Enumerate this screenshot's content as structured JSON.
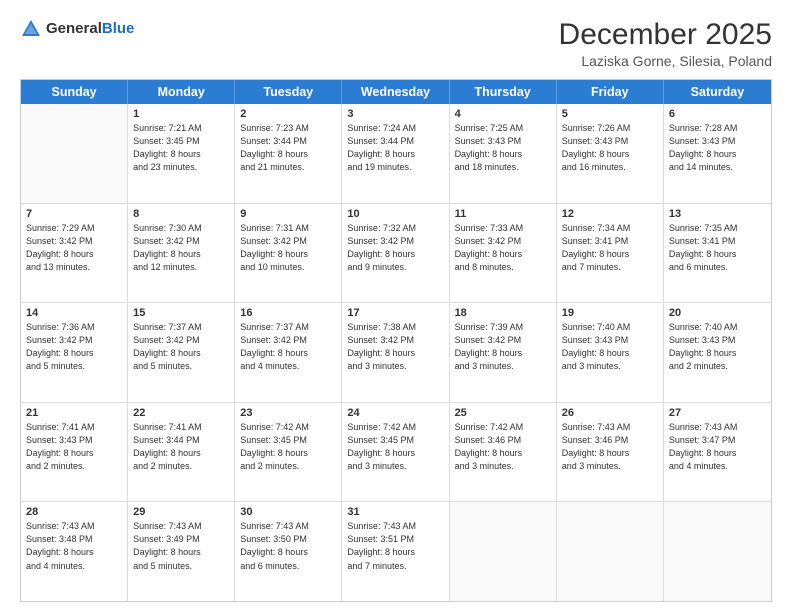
{
  "logo": {
    "general": "General",
    "blue": "Blue"
  },
  "title": "December 2025",
  "subtitle": "Laziska Gorne, Silesia, Poland",
  "calendar": {
    "headers": [
      "Sunday",
      "Monday",
      "Tuesday",
      "Wednesday",
      "Thursday",
      "Friday",
      "Saturday"
    ],
    "rows": [
      [
        {
          "day": "",
          "lines": []
        },
        {
          "day": "1",
          "lines": [
            "Sunrise: 7:21 AM",
            "Sunset: 3:45 PM",
            "Daylight: 8 hours",
            "and 23 minutes."
          ]
        },
        {
          "day": "2",
          "lines": [
            "Sunrise: 7:23 AM",
            "Sunset: 3:44 PM",
            "Daylight: 8 hours",
            "and 21 minutes."
          ]
        },
        {
          "day": "3",
          "lines": [
            "Sunrise: 7:24 AM",
            "Sunset: 3:44 PM",
            "Daylight: 8 hours",
            "and 19 minutes."
          ]
        },
        {
          "day": "4",
          "lines": [
            "Sunrise: 7:25 AM",
            "Sunset: 3:43 PM",
            "Daylight: 8 hours",
            "and 18 minutes."
          ]
        },
        {
          "day": "5",
          "lines": [
            "Sunrise: 7:26 AM",
            "Sunset: 3:43 PM",
            "Daylight: 8 hours",
            "and 16 minutes."
          ]
        },
        {
          "day": "6",
          "lines": [
            "Sunrise: 7:28 AM",
            "Sunset: 3:43 PM",
            "Daylight: 8 hours",
            "and 14 minutes."
          ]
        }
      ],
      [
        {
          "day": "7",
          "lines": [
            "Sunrise: 7:29 AM",
            "Sunset: 3:42 PM",
            "Daylight: 8 hours",
            "and 13 minutes."
          ]
        },
        {
          "day": "8",
          "lines": [
            "Sunrise: 7:30 AM",
            "Sunset: 3:42 PM",
            "Daylight: 8 hours",
            "and 12 minutes."
          ]
        },
        {
          "day": "9",
          "lines": [
            "Sunrise: 7:31 AM",
            "Sunset: 3:42 PM",
            "Daylight: 8 hours",
            "and 10 minutes."
          ]
        },
        {
          "day": "10",
          "lines": [
            "Sunrise: 7:32 AM",
            "Sunset: 3:42 PM",
            "Daylight: 8 hours",
            "and 9 minutes."
          ]
        },
        {
          "day": "11",
          "lines": [
            "Sunrise: 7:33 AM",
            "Sunset: 3:42 PM",
            "Daylight: 8 hours",
            "and 8 minutes."
          ]
        },
        {
          "day": "12",
          "lines": [
            "Sunrise: 7:34 AM",
            "Sunset: 3:41 PM",
            "Daylight: 8 hours",
            "and 7 minutes."
          ]
        },
        {
          "day": "13",
          "lines": [
            "Sunrise: 7:35 AM",
            "Sunset: 3:41 PM",
            "Daylight: 8 hours",
            "and 6 minutes."
          ]
        }
      ],
      [
        {
          "day": "14",
          "lines": [
            "Sunrise: 7:36 AM",
            "Sunset: 3:42 PM",
            "Daylight: 8 hours",
            "and 5 minutes."
          ]
        },
        {
          "day": "15",
          "lines": [
            "Sunrise: 7:37 AM",
            "Sunset: 3:42 PM",
            "Daylight: 8 hours",
            "and 5 minutes."
          ]
        },
        {
          "day": "16",
          "lines": [
            "Sunrise: 7:37 AM",
            "Sunset: 3:42 PM",
            "Daylight: 8 hours",
            "and 4 minutes."
          ]
        },
        {
          "day": "17",
          "lines": [
            "Sunrise: 7:38 AM",
            "Sunset: 3:42 PM",
            "Daylight: 8 hours",
            "and 3 minutes."
          ]
        },
        {
          "day": "18",
          "lines": [
            "Sunrise: 7:39 AM",
            "Sunset: 3:42 PM",
            "Daylight: 8 hours",
            "and 3 minutes."
          ]
        },
        {
          "day": "19",
          "lines": [
            "Sunrise: 7:40 AM",
            "Sunset: 3:43 PM",
            "Daylight: 8 hours",
            "and 3 minutes."
          ]
        },
        {
          "day": "20",
          "lines": [
            "Sunrise: 7:40 AM",
            "Sunset: 3:43 PM",
            "Daylight: 8 hours",
            "and 2 minutes."
          ]
        }
      ],
      [
        {
          "day": "21",
          "lines": [
            "Sunrise: 7:41 AM",
            "Sunset: 3:43 PM",
            "Daylight: 8 hours",
            "and 2 minutes."
          ]
        },
        {
          "day": "22",
          "lines": [
            "Sunrise: 7:41 AM",
            "Sunset: 3:44 PM",
            "Daylight: 8 hours",
            "and 2 minutes."
          ]
        },
        {
          "day": "23",
          "lines": [
            "Sunrise: 7:42 AM",
            "Sunset: 3:45 PM",
            "Daylight: 8 hours",
            "and 2 minutes."
          ]
        },
        {
          "day": "24",
          "lines": [
            "Sunrise: 7:42 AM",
            "Sunset: 3:45 PM",
            "Daylight: 8 hours",
            "and 3 minutes."
          ]
        },
        {
          "day": "25",
          "lines": [
            "Sunrise: 7:42 AM",
            "Sunset: 3:46 PM",
            "Daylight: 8 hours",
            "and 3 minutes."
          ]
        },
        {
          "day": "26",
          "lines": [
            "Sunrise: 7:43 AM",
            "Sunset: 3:46 PM",
            "Daylight: 8 hours",
            "and 3 minutes."
          ]
        },
        {
          "day": "27",
          "lines": [
            "Sunrise: 7:43 AM",
            "Sunset: 3:47 PM",
            "Daylight: 8 hours",
            "and 4 minutes."
          ]
        }
      ],
      [
        {
          "day": "28",
          "lines": [
            "Sunrise: 7:43 AM",
            "Sunset: 3:48 PM",
            "Daylight: 8 hours",
            "and 4 minutes."
          ]
        },
        {
          "day": "29",
          "lines": [
            "Sunrise: 7:43 AM",
            "Sunset: 3:49 PM",
            "Daylight: 8 hours",
            "and 5 minutes."
          ]
        },
        {
          "day": "30",
          "lines": [
            "Sunrise: 7:43 AM",
            "Sunset: 3:50 PM",
            "Daylight: 8 hours",
            "and 6 minutes."
          ]
        },
        {
          "day": "31",
          "lines": [
            "Sunrise: 7:43 AM",
            "Sunset: 3:51 PM",
            "Daylight: 8 hours",
            "and 7 minutes."
          ]
        },
        {
          "day": "",
          "lines": []
        },
        {
          "day": "",
          "lines": []
        },
        {
          "day": "",
          "lines": []
        }
      ]
    ]
  }
}
